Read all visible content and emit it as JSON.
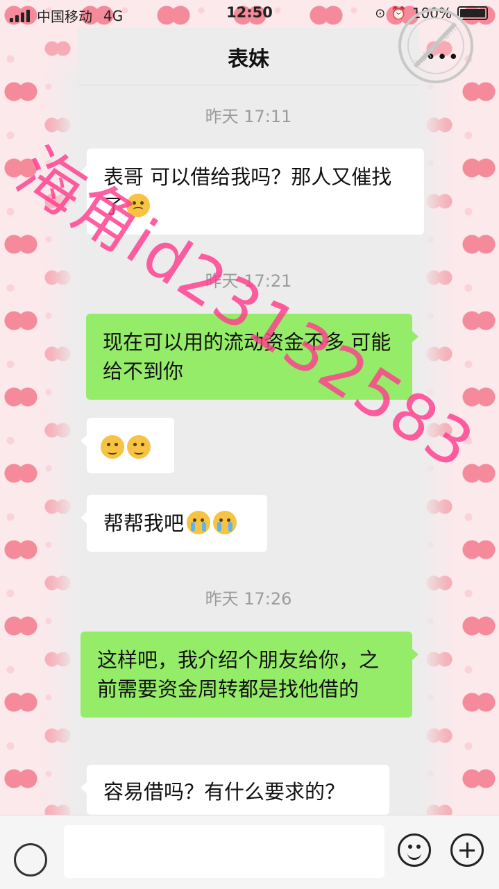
{
  "status_bar": {
    "carrier": "中国移动",
    "network": "4G",
    "time": "12:50",
    "battery": "100%"
  },
  "nav": {
    "title": "表妹",
    "more_icon": "more-icon"
  },
  "watermark": {
    "overlay_text": "海角id23132583",
    "logo_text": "haijiao.com"
  },
  "messages": [
    {
      "type": "time",
      "text": "昨天 17:11"
    },
    {
      "type": "incoming",
      "text": "表哥 可以借给我吗？那人又催找了",
      "emoji": [
        "sweat-face-emoji"
      ]
    },
    {
      "type": "time",
      "text": "昨天 17:21"
    },
    {
      "type": "outgoing",
      "text": "现在可以用的流动资金不多 可能给不到你"
    },
    {
      "type": "incoming",
      "text": "",
      "emoji": [
        "frown-face-emoji",
        "frown-face-emoji"
      ]
    },
    {
      "type": "incoming",
      "text": "帮帮我吧",
      "emoji": [
        "crying-face-emoji",
        "crying-face-emoji"
      ]
    },
    {
      "type": "time",
      "text": "昨天 17:26"
    },
    {
      "type": "outgoing",
      "text": "这样吧，我介绍个朋友给你，之前需要资金周转都是找他借的"
    },
    {
      "type": "incoming",
      "text": "容易借吗？有什么要求的？"
    }
  ],
  "input_bar": {
    "voice_icon": "voice-icon",
    "emoji_icon": "emoji-icon",
    "plus_icon": "plus-icon"
  },
  "colors": {
    "outgoing_bubble": "#95ec69",
    "incoming_bubble": "#ffffff",
    "chat_background": "#ececec",
    "watermark": "#ff3c8c"
  }
}
